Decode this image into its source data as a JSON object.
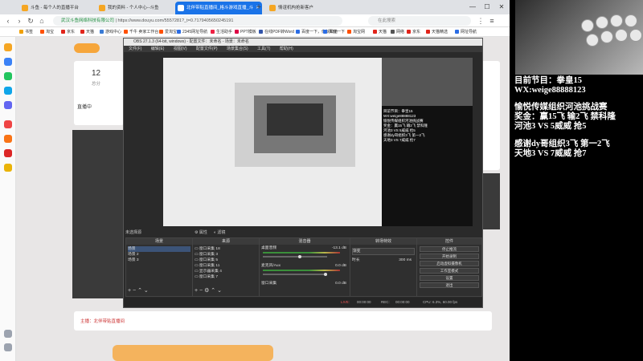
{
  "browser": {
    "tabs": [
      {
        "label": "斗鱼 - 每个人的直播平台",
        "icon_color": "#f5a623"
      },
      {
        "label": "我的资料 - 个人中心--斗鱼",
        "icon_color": "#f5a623"
      },
      {
        "label": "北伴带贴直播间_格斗游戏直播_斗",
        "icon_color": "#ffffff",
        "active": true
      },
      {
        "label": "情谊机构抢新客户",
        "icon_color": "#f5a623"
      }
    ],
    "url_secure": "武汉斗鱼网络科技有限公司",
    "url": "https://www.douyu.com/5557281?_t=0.7179405650245191",
    "search_placeholder": "在此搜索",
    "bookmarks": [
      "书签",
      "淘宝",
      "京东",
      "天猫",
      "游戏中心",
      "千牛 卖家工作台",
      "爱淘宝",
      "2345网址导航",
      "生活助手",
      "PPT模板",
      "在线PDF转Word",
      "百度一下，你就知道",
      "百度一下",
      "淘宝网",
      "天猫",
      "网络",
      "京东",
      "天猫精选",
      "网址导航"
    ],
    "window_controls": [
      "—",
      "☐",
      "✕"
    ]
  },
  "page": {
    "score": "12",
    "score_label": "总分",
    "side_text": "直播中",
    "footer_link": "主播：北伴带贴直播间"
  },
  "obs": {
    "title": "OBS 27.1.3 (64-bit, windows) - 配置文件：未命名 - 场景：未命名",
    "menu": [
      "文件(F)",
      "编辑(E)",
      "视图(V)",
      "配置文件(P)",
      "场景集合(S)",
      "工具(T)",
      "帮助(H)"
    ],
    "preview_overlay": [
      "目前节目：拳皇15",
      "WX:weige88888123",
      "愉悦传媒组织河池挑战赛",
      "奖金：赢15飞 输2飞 禁科隆",
      "河池3 VS 5威威 抢5",
      "感谢dy哥组织3飞 第一2飞",
      "天地3 VS 7威威 抢7"
    ],
    "no_source_label": "未选择源",
    "props_label": "属性",
    "filters_label": "滤镜",
    "docks": {
      "scenes": {
        "title": "场景",
        "items": [
          "场景",
          "场景 2",
          "场景 3"
        ]
      },
      "sources": {
        "title": "来源",
        "items": [
          "窗口采集 18",
          "窗口采集 3",
          "窗口采集 5",
          "窗口采集 11",
          "显示器采集 4",
          "窗口采集 7"
        ]
      },
      "mixer": {
        "title": "混音器",
        "tracks": [
          {
            "name": "桌面音频",
            "db": "-13.1 dB"
          },
          {
            "name": "麦克风/Aux",
            "db": "0.0 dB"
          },
          {
            "name": "窗口采集",
            "db": "0.0 dB"
          }
        ]
      },
      "transitions": {
        "title": "转场特效",
        "type": "渐变",
        "duration_label": "时长",
        "duration": "300 ms"
      },
      "controls": {
        "title": "控件",
        "buttons": [
          "停止推流",
          "开始录制",
          "启动虚拟摄像机",
          "工作室模式",
          "设置",
          "退出"
        ]
      }
    },
    "status": {
      "live_label": "LIVE:",
      "live_time": "00:00:00",
      "rec_label": "REC:",
      "rec_time": "00:00:00",
      "cpu": "CPU: 6.3%, 60.00 fps"
    }
  },
  "overlay_text": {
    "program": "目前节目：拳皇15",
    "wx": "WX:weige88888123",
    "event": "愉悦传媒组织河池挑战赛",
    "prize": "奖金：赢15飞 输2飞 禁科隆",
    "match1": "河池3 VS 5威威 抢5",
    "thanks": "感谢dy哥组织3飞 第一2飞",
    "match2": "天地3 VS 7威威 抢7"
  },
  "colors": {
    "accent": "#1a73e8",
    "obs_bg": "#2a2a2a",
    "douyu_orange": "#f6a63b"
  }
}
